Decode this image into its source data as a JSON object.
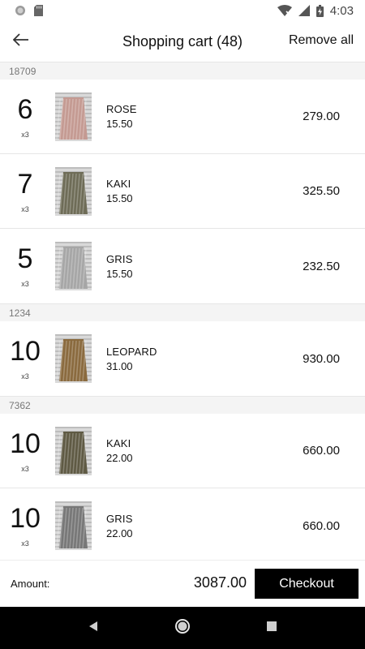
{
  "status_bar": {
    "time": "4:03",
    "icons": [
      "circle-notification-icon",
      "sd-card-icon",
      "wifi-icon",
      "signal-icon",
      "battery-charging-icon"
    ]
  },
  "header": {
    "title": "Shopping cart (48)",
    "remove_all": "Remove all",
    "back_icon": "arrow-left-icon"
  },
  "groups": [
    {
      "id": "18709",
      "items": [
        {
          "qty": "6",
          "mult": "x3",
          "color": "ROSE",
          "unit_price": "15.50",
          "total": "279.00",
          "swatch": "#c49a92"
        },
        {
          "qty": "7",
          "mult": "x3",
          "color": "KAKI",
          "unit_price": "15.50",
          "total": "325.50",
          "swatch": "#6e6c57"
        },
        {
          "qty": "5",
          "mult": "x3",
          "color": "GRIS",
          "unit_price": "15.50",
          "total": "232.50",
          "swatch": "#a6a6a6"
        }
      ]
    },
    {
      "id": "1234",
      "items": [
        {
          "qty": "10",
          "mult": "x3",
          "color": "LEOPARD",
          "unit_price": "31.00",
          "total": "930.00",
          "swatch": "#8a6a3e"
        }
      ]
    },
    {
      "id": "7362",
      "items": [
        {
          "qty": "10",
          "mult": "x3",
          "color": "KAKI",
          "unit_price": "22.00",
          "total": "660.00",
          "swatch": "#5f5a44"
        },
        {
          "qty": "10",
          "mult": "x3",
          "color": "GRIS",
          "unit_price": "22.00",
          "total": "660.00",
          "swatch": "#777777"
        }
      ]
    }
  ],
  "footer": {
    "amount_label": "Amount:",
    "amount_value": "3087.00",
    "checkout_label": "Checkout"
  },
  "nav_bar": {
    "icons": [
      "back-triangle-icon",
      "home-circle-icon",
      "recents-square-icon"
    ]
  },
  "colors": {
    "accent": "#000000",
    "group_header_bg": "#f4f4f4"
  }
}
